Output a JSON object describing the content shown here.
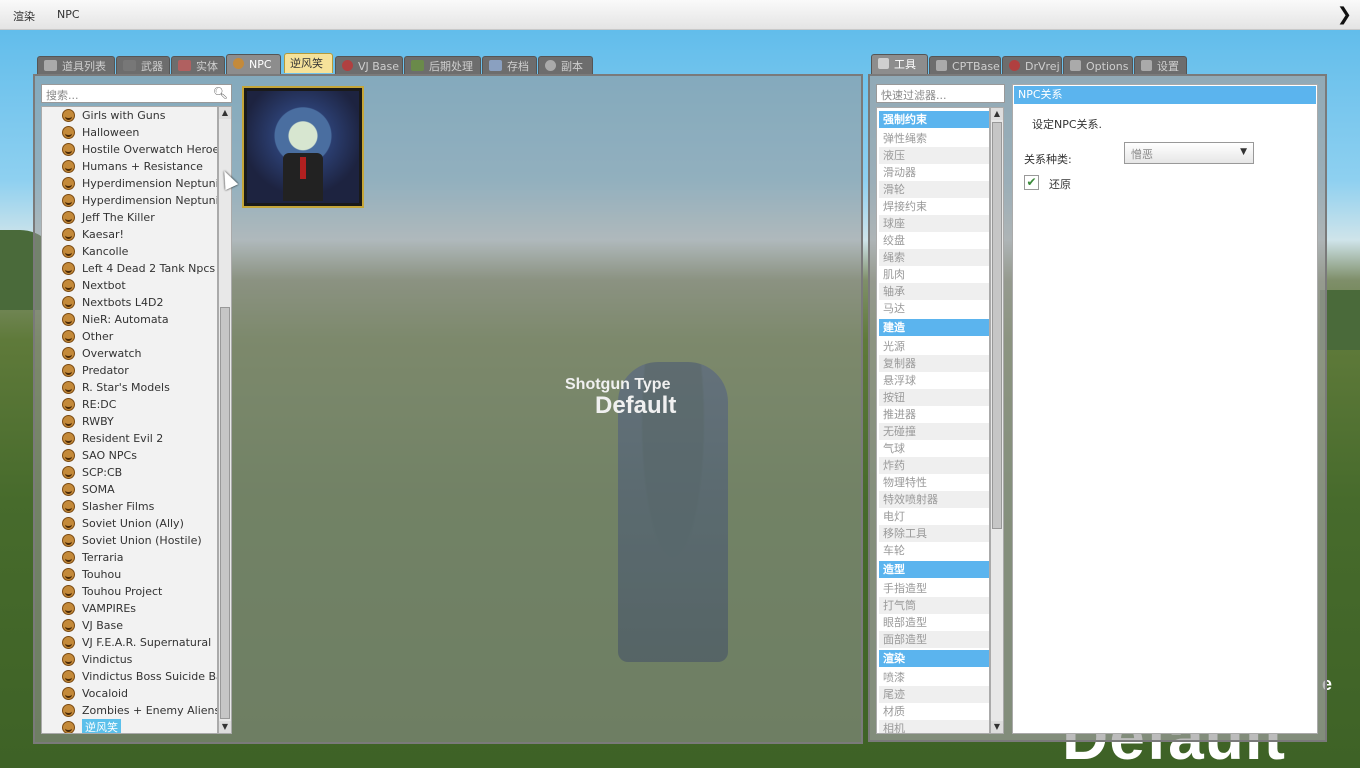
{
  "menubar": {
    "items": [
      "渲染",
      "NPC"
    ],
    "collapse_arrow": "chevron-right"
  },
  "spawn_tabs": [
    {
      "label": "道具列表",
      "icon": "grid-icon",
      "state": "normal"
    },
    {
      "label": "武器",
      "icon": "gun-icon",
      "state": "normal"
    },
    {
      "label": "实体",
      "icon": "entity-icon",
      "state": "normal"
    },
    {
      "label": "NPC",
      "icon": "monkey-face-icon",
      "state": "active"
    },
    {
      "label": "逆风笑",
      "icon": "",
      "state": "highlight"
    },
    {
      "label": "VJ Base",
      "icon": "vj-icon",
      "state": "normal"
    },
    {
      "label": "后期处理",
      "icon": "image-icon",
      "state": "normal"
    },
    {
      "label": "存档",
      "icon": "save-icon",
      "state": "normal"
    },
    {
      "label": "副本",
      "icon": "dupe-icon",
      "state": "normal"
    }
  ],
  "spawn_panel": {
    "search_placeholder": "搜索...",
    "categories": [
      "Girls with Guns",
      "Halloween",
      "Hostile Overwatch Heroes",
      "Humans + Resistance",
      "Hyperdimension Neptunia",
      "Hyperdimension Neptunia...",
      "Jeff The Killer",
      "Kaesar!",
      "Kancolle",
      "Left 4 Dead 2 Tank Npcs",
      "Nextbot",
      "Nextbots L4D2",
      "NieR: Automata",
      "Other",
      "Overwatch",
      "Predator",
      "R. Star's Models",
      "RE:DC",
      "RWBY",
      "Resident Evil 2",
      "SAO NPCs",
      "SCP:CB",
      "SOMA",
      "Slasher Films",
      "Soviet Union (Ally)",
      "Soviet Union (Hostile)",
      "Terraria",
      "Touhou",
      "Touhou Project",
      "VAMPIREs",
      "VJ Base",
      "VJ F.E.A.R. Supernatural",
      "Vindictus",
      "Vindictus Boss Suicide Battle",
      "Vocaloid",
      "Zombies + Enemy Aliens",
      "逆风笑"
    ],
    "selected_category": "逆风笑"
  },
  "overlay": {
    "title": "Shotgun Type",
    "value": "Default"
  },
  "background_text": {
    "big": "Default",
    "small": "e"
  },
  "tool_tabs": [
    {
      "label": "工具",
      "icon": "wrench-icon",
      "state": "active"
    },
    {
      "label": "CPTBase",
      "icon": "wrench-icon",
      "state": "normal"
    },
    {
      "label": "DrVrej",
      "icon": "vj-icon",
      "state": "normal"
    },
    {
      "label": "Options",
      "icon": "wrench-icon",
      "state": "normal"
    },
    {
      "label": "设置",
      "icon": "wrench-icon",
      "state": "normal"
    }
  ],
  "tool_panel": {
    "filter_placeholder": "快速过滤器...",
    "groups": [
      {
        "header": "强制约束",
        "items": [
          "弹性绳索",
          "液压",
          "滑动器",
          "滑轮",
          "焊接约束",
          "球座",
          "绞盘",
          "绳索",
          "肌肉",
          "轴承",
          "马达"
        ]
      },
      {
        "header": "建造",
        "items": [
          "光源",
          "复制器",
          "悬浮球",
          "按钮",
          "推进器",
          "无碰撞",
          "气球",
          "炸药",
          "物理特性",
          "特效喷射器",
          "电灯",
          "移除工具",
          "车轮"
        ]
      },
      {
        "header": "造型",
        "items": [
          "手指造型",
          "打气筒",
          "眼部造型",
          "面部造型"
        ]
      },
      {
        "header": "渲染",
        "items": [
          "喷漆",
          "尾迹",
          "材质",
          "相机"
        ]
      }
    ]
  },
  "properties": {
    "title": "NPC关系",
    "description": "设定NPC关系.",
    "relation_label": "关系种类:",
    "relation_value": "憎恶",
    "restore_checked": true,
    "restore_label": "还原"
  },
  "colors": {
    "accent": "#5bb4ee",
    "highlight_tab": "#f6e29a",
    "selected_row": "#5bc0eb"
  }
}
